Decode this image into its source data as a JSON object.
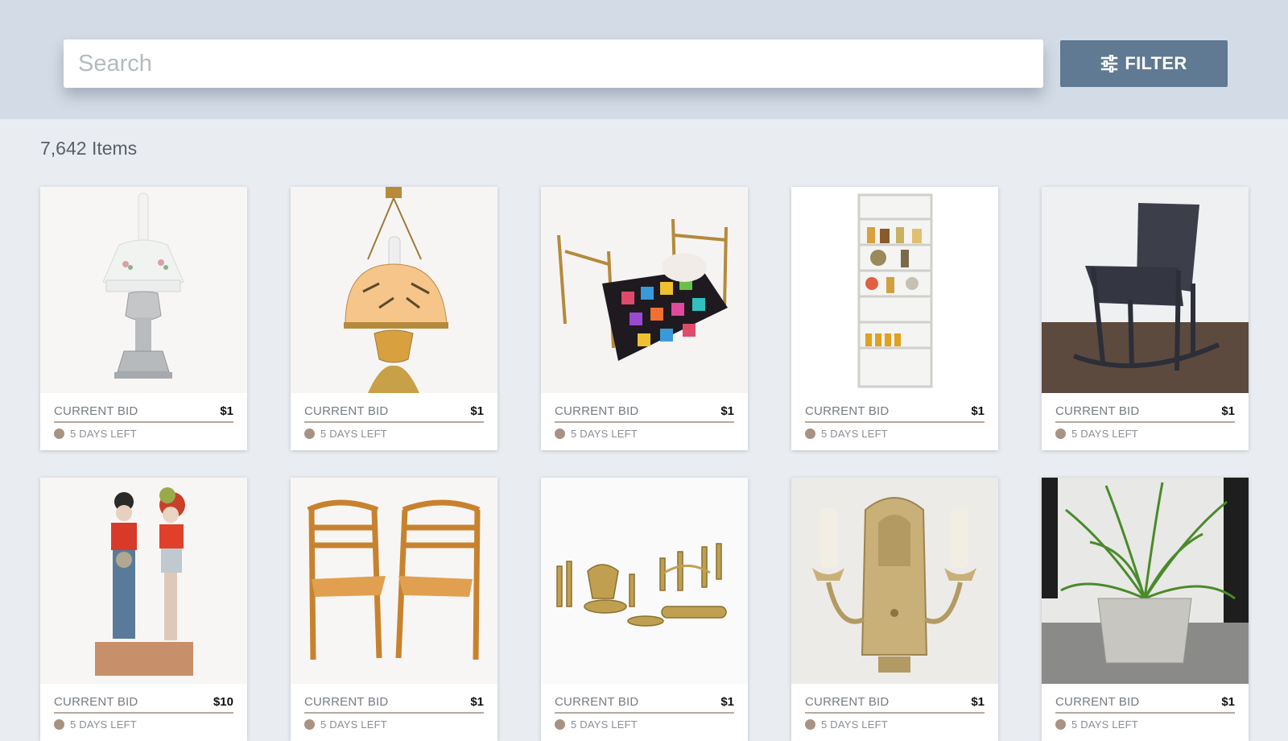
{
  "search": {
    "placeholder": "Search",
    "value": ""
  },
  "filter": {
    "label": "FILTER",
    "icon": "sliders-icon"
  },
  "results": {
    "count_label": "7,642 Items"
  },
  "colors": {
    "header_bg": "#d3dce6",
    "page_bg": "#e9edf2",
    "button_bg": "#5f7a92",
    "accent_line": "#b9a89e",
    "status_dot": "#a89283"
  },
  "items": [
    {
      "title_icon": "oil-lamp-image",
      "bid_label": "CURRENT BID",
      "bid": "$1",
      "time_left": "5 DAYS LEFT"
    },
    {
      "title_icon": "hanging-lamp-image",
      "bid_label": "CURRENT BID",
      "bid": "$1",
      "time_left": "5 DAYS LEFT"
    },
    {
      "title_icon": "doll-bed-image",
      "bid_label": "CURRENT BID",
      "bid": "$1",
      "time_left": "5 DAYS LEFT"
    },
    {
      "title_icon": "shelf-cabinet-image",
      "bid_label": "CURRENT BID",
      "bid": "$1",
      "time_left": "5 DAYS LEFT"
    },
    {
      "title_icon": "rocking-chair-image",
      "bid_label": "CURRENT BID",
      "bid": "$1",
      "time_left": "5 DAYS LEFT"
    },
    {
      "title_icon": "folk-art-figures-image",
      "bid_label": "CURRENT BID",
      "bid": "$10",
      "time_left": "5 DAYS LEFT"
    },
    {
      "title_icon": "wooden-chairs-image",
      "bid_label": "CURRENT BID",
      "bid": "$1",
      "time_left": "5 DAYS LEFT"
    },
    {
      "title_icon": "brass-candlesticks-image",
      "bid_label": "CURRENT BID",
      "bid": "$1",
      "time_left": "5 DAYS LEFT"
    },
    {
      "title_icon": "wall-sconce-image",
      "bid_label": "CURRENT BID",
      "bid": "$1",
      "time_left": "5 DAYS LEFT"
    },
    {
      "title_icon": "potted-plant-image",
      "bid_label": "CURRENT BID",
      "bid": "$1",
      "time_left": "5 DAYS LEFT"
    }
  ]
}
